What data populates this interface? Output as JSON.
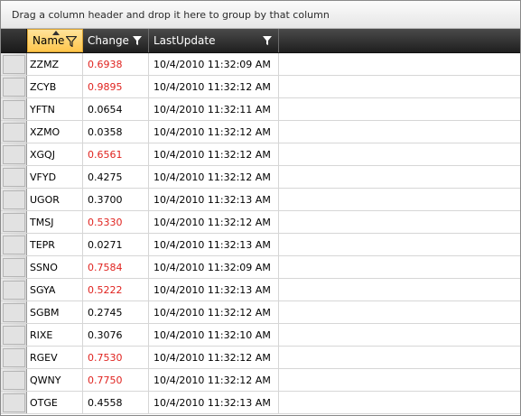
{
  "group_panel": {
    "text": "Drag a column header and drop it here to group by that column"
  },
  "columns": {
    "name": "Name",
    "change": "Change",
    "last_update": "LastUpdate"
  },
  "colors": {
    "positive_change": "#e0231f",
    "header_active": "#ffc64c",
    "header_bg": "#2a2a2a"
  },
  "rows": [
    {
      "name": "ZZMZ",
      "change": "0.6938",
      "red": true,
      "last_update": "10/4/2010 11:32:09 AM"
    },
    {
      "name": "ZCYB",
      "change": "0.9895",
      "red": true,
      "last_update": "10/4/2010 11:32:12 AM"
    },
    {
      "name": "YFTN",
      "change": "0.0654",
      "red": false,
      "last_update": "10/4/2010 11:32:11 AM"
    },
    {
      "name": "XZMO",
      "change": "0.0358",
      "red": false,
      "last_update": "10/4/2010 11:32:12 AM"
    },
    {
      "name": "XGQJ",
      "change": "0.6561",
      "red": true,
      "last_update": "10/4/2010 11:32:12 AM"
    },
    {
      "name": "VFYD",
      "change": "0.4275",
      "red": false,
      "last_update": "10/4/2010 11:32:12 AM"
    },
    {
      "name": "UGOR",
      "change": "0.3700",
      "red": false,
      "last_update": "10/4/2010 11:32:13 AM"
    },
    {
      "name": "TMSJ",
      "change": "0.5330",
      "red": true,
      "last_update": "10/4/2010 11:32:12 AM"
    },
    {
      "name": "TEPR",
      "change": "0.0271",
      "red": false,
      "last_update": "10/4/2010 11:32:13 AM"
    },
    {
      "name": "SSNO",
      "change": "0.7584",
      "red": true,
      "last_update": "10/4/2010 11:32:09 AM"
    },
    {
      "name": "SGYA",
      "change": "0.5222",
      "red": true,
      "last_update": "10/4/2010 11:32:13 AM"
    },
    {
      "name": "SGBM",
      "change": "0.2745",
      "red": false,
      "last_update": "10/4/2010 11:32:12 AM"
    },
    {
      "name": "RIXE",
      "change": "0.3076",
      "red": false,
      "last_update": "10/4/2010 11:32:10 AM"
    },
    {
      "name": "RGEV",
      "change": "0.7530",
      "red": true,
      "last_update": "10/4/2010 11:32:12 AM"
    },
    {
      "name": "QWNY",
      "change": "0.7750",
      "red": true,
      "last_update": "10/4/2010 11:32:12 AM"
    },
    {
      "name": "OTGE",
      "change": "0.4558",
      "red": false,
      "last_update": "10/4/2010 11:32:13 AM"
    }
  ]
}
